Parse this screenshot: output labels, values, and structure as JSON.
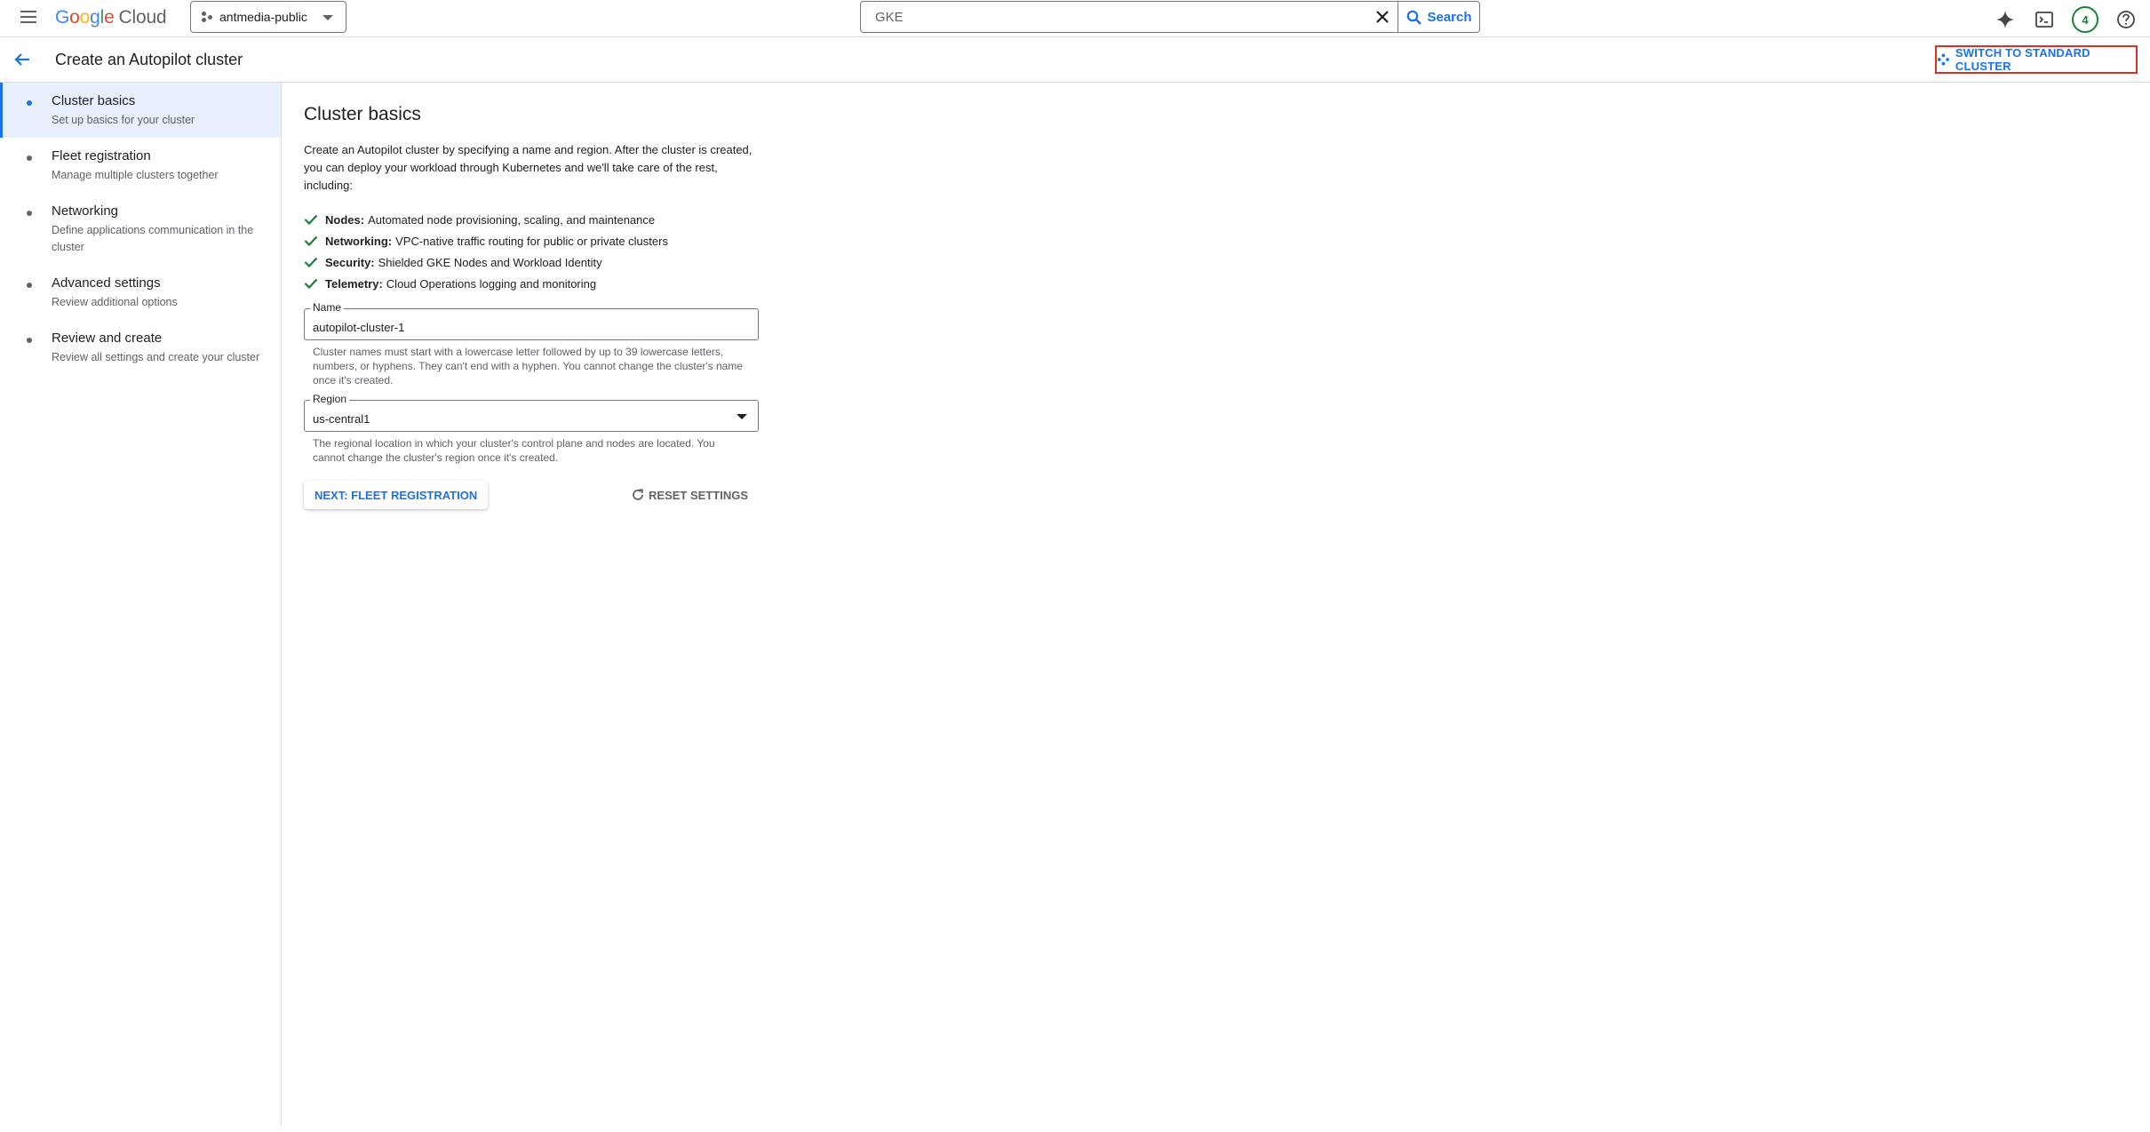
{
  "topbar": {
    "logo": {
      "letters": [
        "G",
        "o",
        "o",
        "g",
        "l",
        "e"
      ],
      "product": "Cloud"
    },
    "project": "antmedia-public",
    "search": {
      "value": "GKE",
      "placeholder": "Search",
      "button_label": "Search"
    },
    "notification_count": "4",
    "icons": [
      "menu-icon",
      "project-icon",
      "close-icon",
      "search-icon",
      "sparkle-icon",
      "terminal-icon",
      "help-icon"
    ]
  },
  "header": {
    "title": "Create an Autopilot cluster",
    "switch_label": "SWITCH TO STANDARD CLUSTER"
  },
  "sidebar": {
    "items": [
      {
        "title": "Cluster basics",
        "subtitle": "Set up basics for your cluster"
      },
      {
        "title": "Fleet registration",
        "subtitle": "Manage multiple clusters together"
      },
      {
        "title": "Networking",
        "subtitle": "Define applications communication in the cluster"
      },
      {
        "title": "Advanced settings",
        "subtitle": "Review additional options"
      },
      {
        "title": "Review and create",
        "subtitle": "Review all settings and create your cluster"
      }
    ]
  },
  "main": {
    "title": "Cluster basics",
    "intro": "Create an Autopilot cluster by specifying a name and region. After the cluster is created, you can deploy your workload through Kubernetes and we'll take care of the rest, including:",
    "features": [
      {
        "label": "Nodes:",
        "text": "Automated node provisioning, scaling, and maintenance"
      },
      {
        "label": "Networking:",
        "text": "VPC-native traffic routing for public or private clusters"
      },
      {
        "label": "Security:",
        "text": "Shielded GKE Nodes and Workload Identity"
      },
      {
        "label": "Telemetry:",
        "text": "Cloud Operations logging and monitoring"
      }
    ],
    "name_field": {
      "label": "Name",
      "value": "autopilot-cluster-1",
      "help": "Cluster names must start with a lowercase letter followed by up to 39 lowercase letters, numbers, or hyphens. They can't end with a hyphen. You cannot change the cluster's name once it's created."
    },
    "region_field": {
      "label": "Region",
      "value": "us-central1",
      "help": "The regional location in which your cluster's control plane and nodes are located. You cannot change the cluster's region once it's created."
    },
    "next_label": "NEXT: FLEET REGISTRATION",
    "reset_label": "RESET SETTINGS"
  },
  "colors": {
    "accent": "#1a73e8",
    "check": "#188038",
    "highlight_border": "#d93025",
    "active_nav_bg": "#e8f0fe"
  }
}
